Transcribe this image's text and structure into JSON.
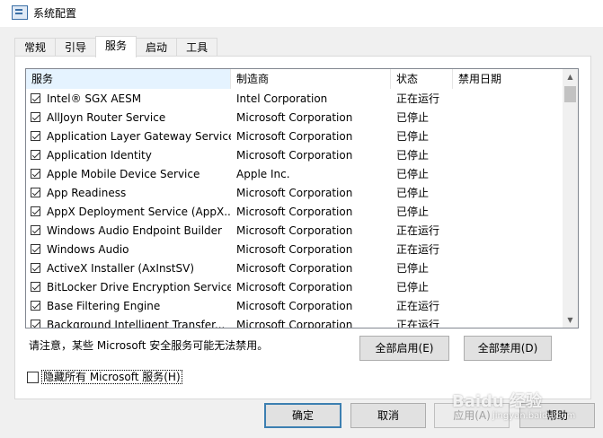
{
  "window": {
    "title": "系统配置"
  },
  "tabs": [
    "常规",
    "引导",
    "服务",
    "启动",
    "工具"
  ],
  "active_tab": "服务",
  "columns": [
    "服务",
    "制造商",
    "状态",
    "禁用日期"
  ],
  "services": [
    {
      "checked": true,
      "name": "Intel® SGX AESM",
      "maker": "Intel Corporation",
      "status": "正在运行",
      "disabled_date": ""
    },
    {
      "checked": true,
      "name": "AllJoyn Router Service",
      "maker": "Microsoft Corporation",
      "status": "已停止",
      "disabled_date": ""
    },
    {
      "checked": true,
      "name": "Application Layer Gateway Service",
      "maker": "Microsoft Corporation",
      "status": "已停止",
      "disabled_date": ""
    },
    {
      "checked": true,
      "name": "Application Identity",
      "maker": "Microsoft Corporation",
      "status": "已停止",
      "disabled_date": ""
    },
    {
      "checked": true,
      "name": "Apple Mobile Device Service",
      "maker": "Apple Inc.",
      "status": "已停止",
      "disabled_date": ""
    },
    {
      "checked": true,
      "name": "App Readiness",
      "maker": "Microsoft Corporation",
      "status": "已停止",
      "disabled_date": ""
    },
    {
      "checked": true,
      "name": "AppX Deployment Service (AppX...",
      "maker": "Microsoft Corporation",
      "status": "已停止",
      "disabled_date": ""
    },
    {
      "checked": true,
      "name": "Windows Audio Endpoint Builder",
      "maker": "Microsoft Corporation",
      "status": "正在运行",
      "disabled_date": ""
    },
    {
      "checked": true,
      "name": "Windows Audio",
      "maker": "Microsoft Corporation",
      "status": "正在运行",
      "disabled_date": ""
    },
    {
      "checked": true,
      "name": "ActiveX Installer (AxInstSV)",
      "maker": "Microsoft Corporation",
      "status": "已停止",
      "disabled_date": ""
    },
    {
      "checked": true,
      "name": "BitLocker Drive Encryption Service",
      "maker": "Microsoft Corporation",
      "status": "已停止",
      "disabled_date": ""
    },
    {
      "checked": true,
      "name": "Base Filtering Engine",
      "maker": "Microsoft Corporation",
      "status": "正在运行",
      "disabled_date": ""
    },
    {
      "checked": true,
      "name": "Background Intelligent Transfer...",
      "maker": "Microsoft Corporation",
      "status": "正在运行",
      "disabled_date": ""
    }
  ],
  "note": "请注意，某些 Microsoft 安全服务可能无法禁用。",
  "buttons": {
    "enable_all": "全部启用(E)",
    "disable_all": "全部禁用(D)",
    "ok": "确定",
    "cancel": "取消",
    "apply": "应用(A)",
    "help": "帮助"
  },
  "hide_ms": {
    "label": "隐藏所有 Microsoft 服务(H)",
    "checked": false
  },
  "watermark": {
    "text": "Baidu 经验",
    "url": "jingyan.baidu.com"
  },
  "icons": {
    "app": "msconfig-icon",
    "check": "checkmark-icon",
    "up": "up-arrow-icon",
    "down": "down-arrow-icon"
  }
}
